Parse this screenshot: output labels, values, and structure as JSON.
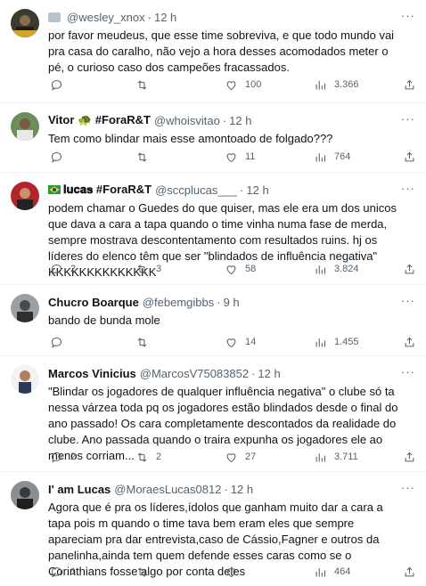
{
  "tweets": [
    {
      "name": "",
      "handle": "@wesley_xnox",
      "time": "12 h",
      "text": "por favor meudeus, que esse time sobreviva, e que todo mundo vai pra casa do caralho, não vejo a hora desses acomodados meter o pé, o curioso caso dos campeões fracassados.",
      "replies": "",
      "retweets": "",
      "likes": "100",
      "views": "3.366"
    },
    {
      "name": "Vitor 🐢 #ForaR&T",
      "handle": "@whoisvitao",
      "time": "12 h",
      "text": "Tem como blindar mais esse amontoado de folgado???",
      "replies": "",
      "retweets": "",
      "likes": "11",
      "views": "764"
    },
    {
      "name": "𝐥𝐮𝐜𝐚𝐬 #ForaR&T",
      "handle": "@sccplucas___",
      "time": "12 h",
      "text": "podem chamar o Guedes do que quiser, mas ele era um dos unicos que dava a cara a tapa quando o time vinha numa fase de merda, sempre mostrava descontentamento com resultados ruins. hj os líderes do elenco têm que ser \"blindados de influência negativa\" KKKKKKKKKKKKKK",
      "replies": "2",
      "retweets": "3",
      "likes": "58",
      "views": "3.824"
    },
    {
      "name": "Chucro Boarque",
      "handle": "@febemgibbs",
      "time": "9 h",
      "text": "bando de bunda mole",
      "replies": "",
      "retweets": "",
      "likes": "14",
      "views": "1.455"
    },
    {
      "name": "Marcos Vinicius",
      "handle": "@MarcosV75083852",
      "time": "12 h",
      "text": "\"Blindar os jogadores de qualquer influência negativa\" o clube só ta nessa várzea toda pq os jogadores estão blindados desde o final do ano passado! Os cara completamente descontados da realidade do clube. Ano passada quando o traira expunha os jogadores ele ao menos corriam...",
      "replies": "2",
      "retweets": "2",
      "likes": "27",
      "views": "3.711"
    },
    {
      "name": "I' am Lucas",
      "handle": "@MoraesLucas0812",
      "time": "12 h",
      "text": "Agora que é pra os líderes,ídolos que ganham muito dar a cara a tapa pois m quando o time tava bem eram eles que sempre apareciam pra dar entrevista,caso de Cássio,Fagner e outros da panelinha,ainda tem quem defende esses caras como se o Corinthians fosse algo por conta deles",
      "replies": "1",
      "retweets": "",
      "likes": "",
      "views": "464"
    }
  ],
  "colors": {
    "text": "#0f1419",
    "muted": "#536471",
    "divider": "#eff3f4"
  }
}
